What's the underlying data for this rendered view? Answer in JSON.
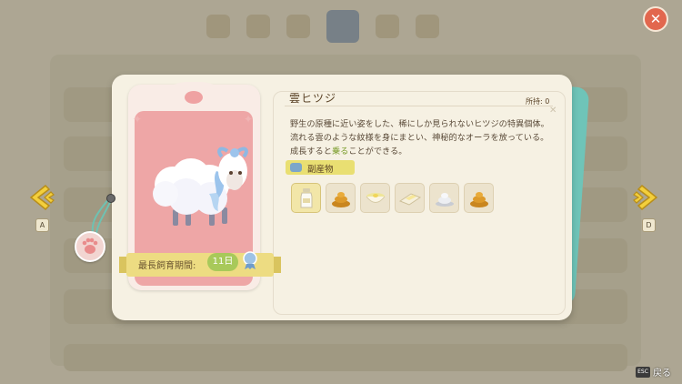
{
  "animal": {
    "name": "雲ヒツジ",
    "owned": "所持: 0",
    "description_parts": [
      "野生の原種に近い姿をした、稀にしか見られないヒツジの特異個体。流れる雲のような紋様を身にまとい、神秘的なオーラを放っている。成長すると",
      "乗る",
      "ことができる。"
    ],
    "max_breeding_label": "最長飼育期間:",
    "max_breeding_value": "11日"
  },
  "byproducts": {
    "label": "副産物",
    "items": [
      {
        "icon": "milk-bottle-icon",
        "selected": true
      },
      {
        "icon": "manure-icon",
        "selected": false
      },
      {
        "icon": "egg-bowl-icon",
        "selected": false
      },
      {
        "icon": "butter-icon",
        "selected": false
      },
      {
        "icon": "cream-icon",
        "selected": false
      },
      {
        "icon": "manure-icon",
        "selected": false
      }
    ]
  },
  "nav": {
    "left_key": "A",
    "right_key": "D"
  },
  "footer": {
    "esc_key": "ESC",
    "back_label": "戻る"
  },
  "colors": {
    "close_button": "#e2674e",
    "portrait_bg": "#eea6a6",
    "ribbon": "#e9d87a",
    "highlight_text": "#7a9c2a",
    "accent_teal": "#6fc4b8"
  }
}
